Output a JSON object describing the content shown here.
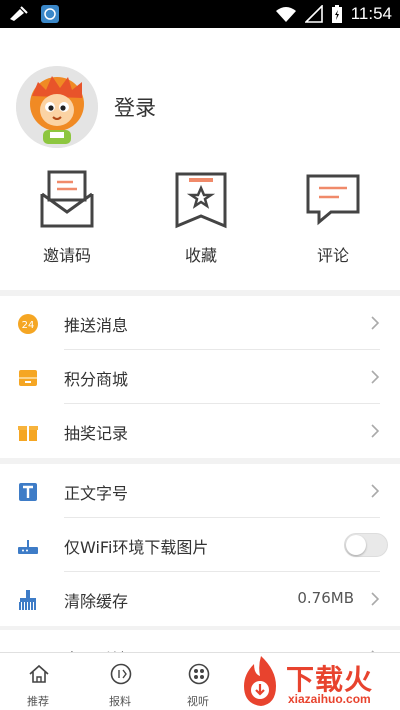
{
  "status_bar": {
    "time": "11:54"
  },
  "profile": {
    "login_label": "登录"
  },
  "quick_actions": [
    {
      "label": "邀请码",
      "icon": "envelope-icon"
    },
    {
      "label": "收藏",
      "icon": "bookmark-star-icon"
    },
    {
      "label": "评论",
      "icon": "comment-icon"
    }
  ],
  "menu_group_1": [
    {
      "label": "推送消息",
      "icon": "push-24-icon"
    },
    {
      "label": "积分商城",
      "icon": "points-mall-icon"
    },
    {
      "label": "抽奖记录",
      "icon": "gift-icon"
    }
  ],
  "menu_group_2": {
    "font_size": {
      "label": "正文字号",
      "icon": "font-size-icon"
    },
    "wifi_images": {
      "label": "仅WiFi环境下载图片",
      "icon": "router-icon",
      "enabled": false
    },
    "clear_cache": {
      "label": "清除缓存",
      "value": "0.76MB",
      "icon": "broom-icon"
    }
  },
  "menu_group_3": {
    "label": "意见反馈"
  },
  "tabs": [
    {
      "label": "推荐",
      "icon": "home-icon"
    },
    {
      "label": "报料",
      "icon": "report-icon"
    },
    {
      "label": "视听",
      "icon": "film-icon"
    }
  ],
  "watermark": {
    "text": "下载火",
    "sub": "xiazaihuo.com"
  },
  "colors": {
    "accent_orange": "#f5a623",
    "brand_red": "#e8432e",
    "tile_blue": "#3e7cc7"
  }
}
